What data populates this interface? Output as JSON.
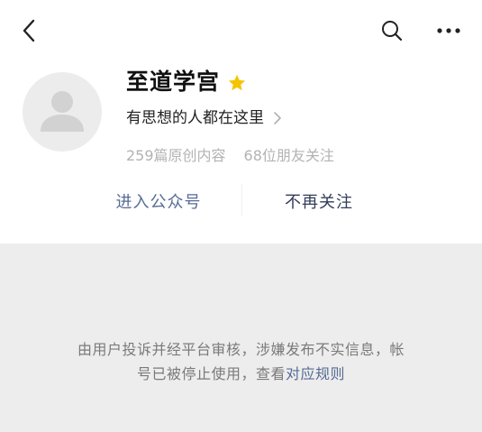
{
  "nav": {
    "back_icon": "chevron-left-icon",
    "search_icon": "search-icon",
    "more_icon": "more-horizontal-icon"
  },
  "profile": {
    "name": "至道学宫",
    "badge_icon": "star-icon",
    "badge_color": "#f5c400",
    "intro": "有思想的人都在这里",
    "original_count": "259篇原创内容",
    "followers_count": "68位朋友关注"
  },
  "actions": {
    "enter_label": "进入公众号",
    "unfollow_label": "不再关注"
  },
  "notice": {
    "line1": "由用户投诉并经平台审核，涉嫌发布不实信息，帐",
    "line2_prefix": "号已被停止使用，查看",
    "link_text": "对应规则"
  },
  "colors": {
    "link": "#576b95",
    "background": "#ededed"
  }
}
